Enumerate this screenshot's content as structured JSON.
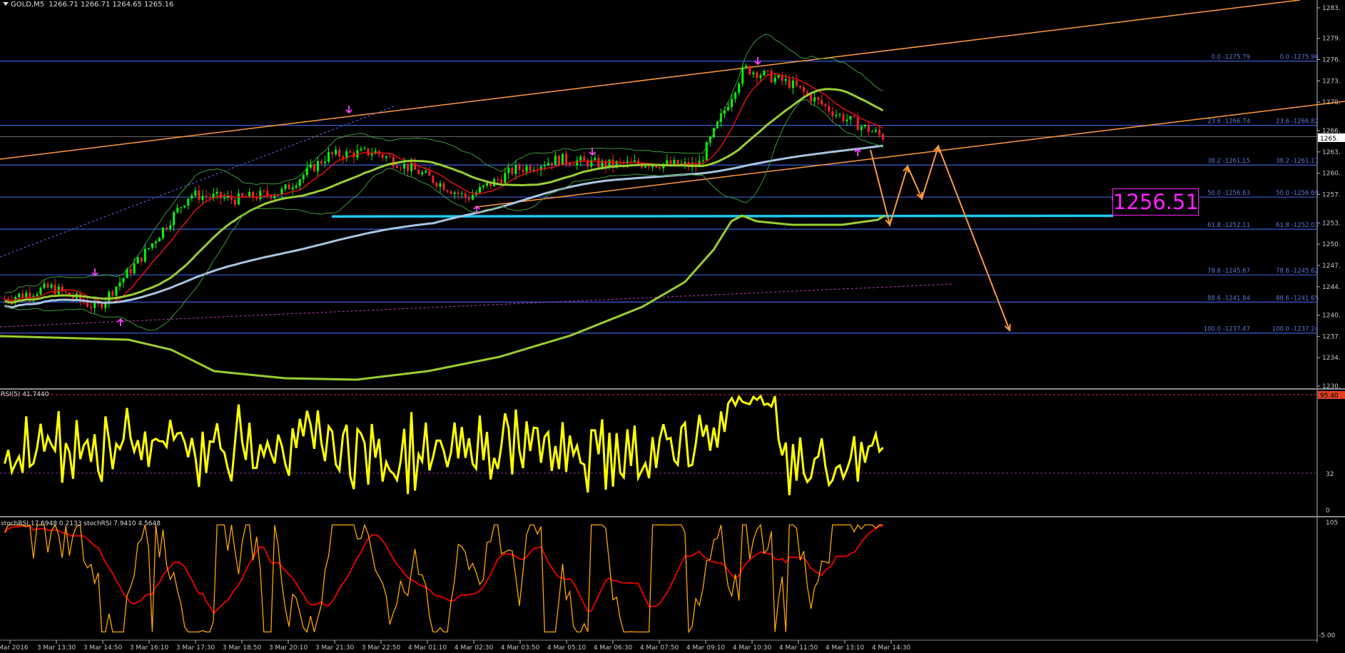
{
  "header": {
    "symbol": "GOLD,M5",
    "ohlc": "1266.71 1266.71 1264.65 1265.16"
  },
  "price_axis": {
    "ticks": [
      "1283.",
      "1279.",
      "1276.",
      "1273.",
      "1270.",
      "1266.",
      "1265.",
      "1263.",
      "1260.",
      "1257.",
      "1253.",
      "1250.",
      "1247.",
      "1244.",
      "1240.",
      "1237.",
      "1234.",
      "1230."
    ],
    "current_price_label": "1265."
  },
  "fibonacci": {
    "left_labels": [
      "0.0 -1275.79",
      "23.6 -1266.74",
      "38.2 -1261.15",
      "50.0 -1256.63",
      "61.8 -1252.11",
      "78.6 -1245.67",
      "88.6 -1241.84",
      "100.0 -1237.47"
    ],
    "right_labels": [
      "0.0 -1275.96",
      "23.6 -1266.82",
      "38.2 -1261.17",
      "50.0 -1256.60",
      "61.8 -1252.03",
      "78.6 -1245.62",
      "88.6 -1241.65",
      "100.0 -1237.24"
    ]
  },
  "target_label": "1256.51",
  "rsi_panel": {
    "label": "RSI(5) 41.7440",
    "axis_ticks": [
      "95.40",
      "32",
      "0"
    ]
  },
  "stoch_panel": {
    "label": "stochRSI 17.6948 0.2133  stochRSI 7.9410 4.5648",
    "axis_ticks": [
      "105",
      "-5.00"
    ]
  },
  "time_axis": [
    "3 Mar 2016",
    "3 Mar 13:30",
    "3 Mar 14:50",
    "3 Mar 16:10",
    "3 Mar 17:30",
    "3 Mar 18:50",
    "3 Mar 20:10",
    "3 Mar 21:30",
    "3 Mar 22:50",
    "4 Mar 01:10",
    "4 Mar 02:30",
    "4 Mar 03:50",
    "4 Mar 05:10",
    "4 Mar 06:30",
    "4 Mar 07:50",
    "4 Mar 09:10",
    "4 Mar 10:30",
    "4 Mar 11:50",
    "4 Mar 13:10",
    "4 Mar 14:30"
  ],
  "colors": {
    "bull": "#00ff00",
    "bear": "#ff2020",
    "fib": "#3c5cd8",
    "channel": "#ff9a3c",
    "support": "#1ec8f0",
    "bb_wide": "#9acd32",
    "rsi": "#ffff00",
    "stoch_k": "#ffa500",
    "stoch_d": "#e00000",
    "target": "#ff20ff"
  },
  "chart_data": {
    "type": "candlestick",
    "instrument": "GOLD",
    "timeframe": "M5",
    "ylim": [
      1230,
      1284
    ],
    "x_range": [
      "3 Mar 2016",
      "4 Mar 14:30"
    ],
    "fib_levels": [
      {
        "ratio": "0.0",
        "price": 1275.79
      },
      {
        "ratio": "23.6",
        "price": 1266.74
      },
      {
        "ratio": "38.2",
        "price": 1261.15
      },
      {
        "ratio": "50.0",
        "price": 1256.63
      },
      {
        "ratio": "61.8",
        "price": 1252.11
      },
      {
        "ratio": "78.6",
        "price": 1245.67
      },
      {
        "ratio": "88.6",
        "price": 1241.84
      },
      {
        "ratio": "100.0",
        "price": 1237.47
      }
    ],
    "support_level": 1254.0,
    "target_price": 1256.51,
    "last_close": 1265.16,
    "price_path": [
      [
        "3 Mar 2016",
        1242.3
      ],
      [
        "3 Mar 13:30",
        1243.9
      ],
      [
        "3 Mar 14:50",
        1241.0
      ],
      [
        "3 Mar 16:10",
        1248.5
      ],
      [
        "3 Mar 17:30",
        1257.0
      ],
      [
        "3 Mar 18:50",
        1256.3
      ],
      [
        "3 Mar 20:10",
        1257.4
      ],
      [
        "3 Mar 21:30",
        1262.5
      ],
      [
        "3 Mar 22:50",
        1263.0
      ],
      [
        "4 Mar 01:10",
        1260.0
      ],
      [
        "4 Mar 02:30",
        1256.5
      ],
      [
        "4 Mar 03:50",
        1260.4
      ],
      [
        "4 Mar 05:10",
        1262.0
      ],
      [
        "4 Mar 06:30",
        1261.2
      ],
      [
        "4 Mar 07:50",
        1261.4
      ],
      [
        "4 Mar 09:10",
        1261.0
      ],
      [
        "4 Mar 10:30",
        1274.8
      ],
      [
        "4 Mar 11:50",
        1272.6
      ],
      [
        "4 Mar 13:10",
        1268.3
      ],
      [
        "4 Mar 14:30",
        1265.16
      ]
    ]
  }
}
